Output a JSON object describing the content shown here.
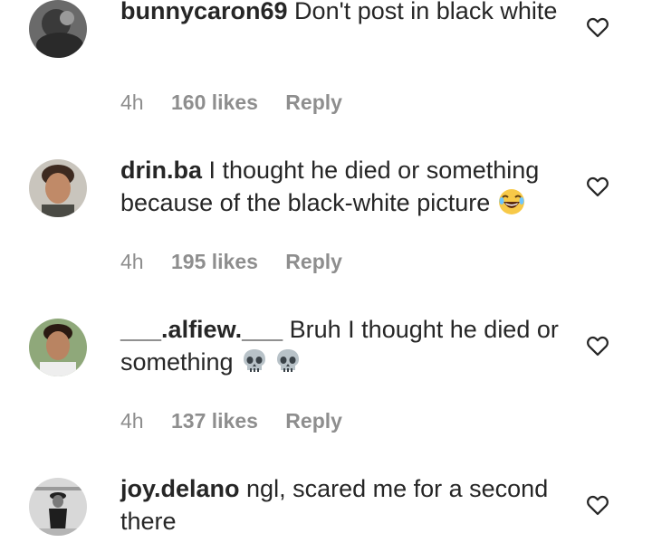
{
  "comments": [
    {
      "username": "bunnycaron69",
      "text": " Don't post in black white",
      "time": "4h",
      "likes": "160 likes",
      "reply": "Reply",
      "emojis": []
    },
    {
      "username": "drin.ba",
      "text": " I thought he died or something because of the black-white picture ",
      "time": "4h",
      "likes": "195 likes",
      "reply": "Reply",
      "emojis": [
        "laughing-emoji"
      ]
    },
    {
      "username": "___.alfiew.___",
      "text": " Bruh I thought he died or something ",
      "time": "4h",
      "likes": "137 likes",
      "reply": "Reply",
      "emojis": [
        "skull-emoji",
        "skull-emoji"
      ]
    },
    {
      "username": "joy.delano",
      "text": " ngl, scared me for a second there",
      "time": "",
      "likes": "",
      "reply": "",
      "emojis": []
    }
  ],
  "colors": {
    "text": "#262626",
    "meta": "#8e8e8e",
    "heart_outline": "#262626"
  },
  "icons": [
    "heart-outline-icon"
  ]
}
